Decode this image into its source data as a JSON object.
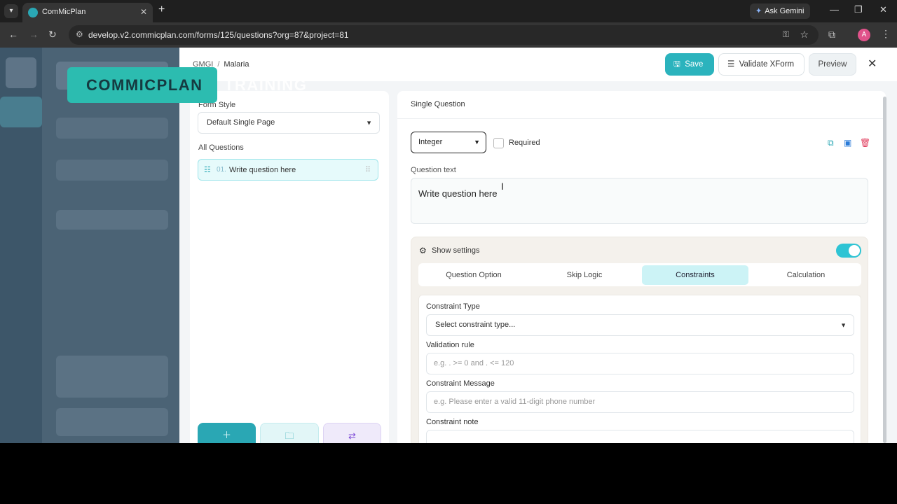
{
  "browser": {
    "tab_title": "ComMicPlan",
    "tab_close": "✕",
    "new_tab": "+",
    "url": "develop.v2.commicplan.com/forms/125/questions?org=87&project=81",
    "gemini_label": "Ask Gemini",
    "profile_initial": "A"
  },
  "header": {
    "breadcrumb": [
      "GMGI",
      "Malaria"
    ],
    "save_label": "Save",
    "validate_label": "Validate XForm",
    "preview_label": "Preview"
  },
  "left_panel": {
    "form_style_label": "Form Style",
    "form_style_value": "Default Single Page",
    "all_questions_label": "All Questions",
    "questions": [
      {
        "number": "01.",
        "text": "Write question here"
      }
    ]
  },
  "right_panel": {
    "title": "Single Question",
    "question_type": "Integer",
    "required_label": "Required",
    "question_text_label": "Question text",
    "question_text_value": "Write question here",
    "settings_label": "Show settings",
    "settings_enabled": true,
    "tabs": [
      {
        "label": "Question Option",
        "active": false
      },
      {
        "label": "Skip Logic",
        "active": false
      },
      {
        "label": "Constraints",
        "active": true
      },
      {
        "label": "Calculation",
        "active": false
      }
    ],
    "constraints": {
      "type_label": "Constraint Type",
      "type_value": "Select constraint type...",
      "validation_label": "Validation rule",
      "validation_placeholder": "e.g. . >= 0 and . <= 120",
      "message_label": "Constraint Message",
      "message_placeholder": "e.g. Please enter a valid 11-digit phone number",
      "note_label": "Constraint note"
    }
  },
  "watermark": {
    "part1": "COMMICPLAN",
    "part2": "TRAINING"
  },
  "colors": {
    "accent": "#2bb3bd",
    "active_tab": "#ccf3f6",
    "toggle_on": "#2ec4d4"
  }
}
